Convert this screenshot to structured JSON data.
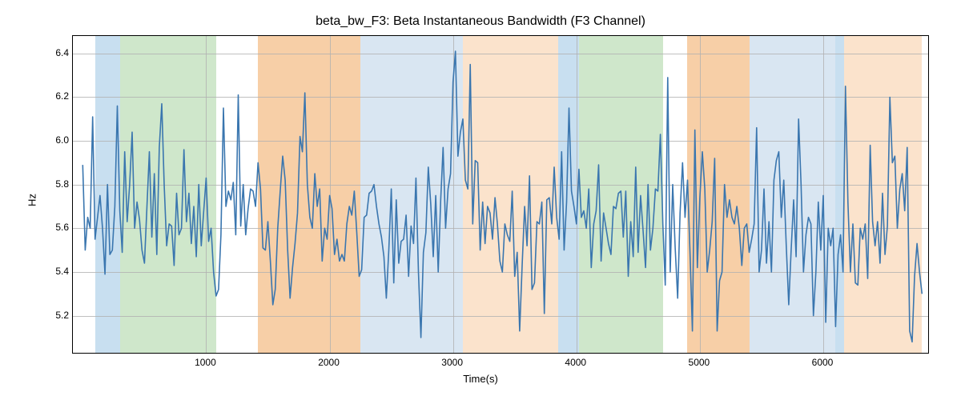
{
  "chart_data": {
    "type": "line",
    "title": "beta_bw_F3: Beta Instantaneous Bandwidth (F3 Channel)",
    "xlabel": "Time(s)",
    "ylabel": "Hz",
    "xlim": [
      -80,
      6850
    ],
    "ylim": [
      5.03,
      6.48
    ],
    "xticks": [
      1000,
      2000,
      3000,
      4000,
      5000,
      6000
    ],
    "yticks": [
      5.2,
      5.4,
      5.6,
      5.8,
      6.0,
      6.2,
      6.4
    ],
    "bands": [
      {
        "start": 100,
        "end": 300,
        "color": "#c8dff0"
      },
      {
        "start": 300,
        "end": 1080,
        "color": "#cfe7cb"
      },
      {
        "start": 1420,
        "end": 2250,
        "color": "#f7cfa7"
      },
      {
        "start": 2250,
        "end": 3080,
        "color": "#d9e6f2"
      },
      {
        "start": 3080,
        "end": 3850,
        "color": "#fbe3cc"
      },
      {
        "start": 3850,
        "end": 4020,
        "color": "#c8dff0"
      },
      {
        "start": 4020,
        "end": 4700,
        "color": "#cfe7cb"
      },
      {
        "start": 4900,
        "end": 5400,
        "color": "#f7cfa7"
      },
      {
        "start": 5400,
        "end": 6100,
        "color": "#d9e6f2"
      },
      {
        "start": 6100,
        "end": 6170,
        "color": "#c8dff0"
      },
      {
        "start": 6170,
        "end": 6800,
        "color": "#fbe3cc"
      }
    ],
    "series": [
      {
        "name": "beta_bw_F3",
        "color": "#3a76af",
        "x": [
          0,
          20,
          40,
          60,
          80,
          100,
          120,
          140,
          160,
          180,
          200,
          220,
          240,
          260,
          280,
          300,
          320,
          340,
          360,
          380,
          400,
          420,
          440,
          460,
          480,
          500,
          520,
          540,
          560,
          580,
          600,
          620,
          640,
          660,
          680,
          700,
          720,
          740,
          760,
          780,
          800,
          820,
          840,
          860,
          880,
          900,
          920,
          940,
          960,
          980,
          1000,
          1020,
          1040,
          1060,
          1080,
          1100,
          1120,
          1140,
          1160,
          1180,
          1200,
          1220,
          1240,
          1260,
          1280,
          1300,
          1320,
          1340,
          1360,
          1380,
          1400,
          1420,
          1440,
          1460,
          1480,
          1500,
          1520,
          1540,
          1560,
          1580,
          1600,
          1620,
          1640,
          1660,
          1680,
          1700,
          1720,
          1740,
          1760,
          1780,
          1800,
          1820,
          1840,
          1860,
          1880,
          1900,
          1920,
          1940,
          1960,
          1980,
          2000,
          2020,
          2040,
          2060,
          2080,
          2100,
          2120,
          2140,
          2160,
          2180,
          2200,
          2220,
          2240,
          2260,
          2280,
          2300,
          2320,
          2340,
          2360,
          2380,
          2400,
          2420,
          2440,
          2460,
          2480,
          2500,
          2520,
          2540,
          2560,
          2580,
          2600,
          2620,
          2640,
          2660,
          2680,
          2700,
          2720,
          2740,
          2760,
          2780,
          2800,
          2820,
          2840,
          2860,
          2880,
          2900,
          2920,
          2940,
          2960,
          2980,
          3000,
          3020,
          3040,
          3060,
          3080,
          3100,
          3120,
          3140,
          3160,
          3180,
          3200,
          3220,
          3240,
          3260,
          3280,
          3300,
          3320,
          3340,
          3360,
          3380,
          3400,
          3420,
          3440,
          3460,
          3480,
          3500,
          3520,
          3540,
          3560,
          3580,
          3600,
          3620,
          3640,
          3660,
          3680,
          3700,
          3720,
          3740,
          3760,
          3780,
          3800,
          3820,
          3840,
          3860,
          3880,
          3900,
          3920,
          3940,
          3960,
          3980,
          4000,
          4020,
          4040,
          4060,
          4080,
          4100,
          4120,
          4140,
          4160,
          4180,
          4200,
          4220,
          4240,
          4260,
          4280,
          4300,
          4320,
          4340,
          4360,
          4380,
          4400,
          4420,
          4440,
          4460,
          4480,
          4500,
          4520,
          4540,
          4560,
          4580,
          4600,
          4620,
          4640,
          4660,
          4680,
          4700,
          4720,
          4740,
          4760,
          4780,
          4800,
          4820,
          4840,
          4860,
          4880,
          4900,
          4920,
          4940,
          4960,
          4980,
          5000,
          5020,
          5040,
          5060,
          5080,
          5100,
          5120,
          5140,
          5160,
          5180,
          5200,
          5220,
          5240,
          5260,
          5280,
          5300,
          5320,
          5340,
          5360,
          5380,
          5400,
          5420,
          5440,
          5460,
          5480,
          5500,
          5520,
          5540,
          5560,
          5580,
          5600,
          5620,
          5640,
          5660,
          5680,
          5700,
          5720,
          5740,
          5760,
          5780,
          5800,
          5820,
          5840,
          5860,
          5880,
          5900,
          5920,
          5940,
          5960,
          5980,
          6000,
          6020,
          6040,
          6060,
          6080,
          6100,
          6120,
          6140,
          6160,
          6180,
          6200,
          6220,
          6240,
          6260,
          6280,
          6300,
          6320,
          6340,
          6360,
          6380,
          6400,
          6420,
          6440,
          6460,
          6480,
          6500,
          6520,
          6540,
          6560,
          6580,
          6600,
          6620,
          6640,
          6660,
          6680,
          6700,
          6720,
          6740,
          6760,
          6780,
          6800
        ],
        "y": [
          5.89,
          5.5,
          5.65,
          5.6,
          6.11,
          5.55,
          5.65,
          5.75,
          5.6,
          5.39,
          5.8,
          5.48,
          5.5,
          5.7,
          6.16,
          5.68,
          5.49,
          5.95,
          5.63,
          5.8,
          6.04,
          5.6,
          5.72,
          5.64,
          5.5,
          5.44,
          5.7,
          5.95,
          5.56,
          5.85,
          5.48,
          5.97,
          6.17,
          5.8,
          5.52,
          5.62,
          5.61,
          5.43,
          5.76,
          5.57,
          5.6,
          5.96,
          5.63,
          5.76,
          5.53,
          5.7,
          5.47,
          5.8,
          5.52,
          5.68,
          5.83,
          5.54,
          5.6,
          5.4,
          5.29,
          5.32,
          5.57,
          6.15,
          5.7,
          5.77,
          5.73,
          5.81,
          5.57,
          6.21,
          5.61,
          5.8,
          5.57,
          5.69,
          5.78,
          5.77,
          5.7,
          5.9,
          5.78,
          5.51,
          5.5,
          5.63,
          5.45,
          5.25,
          5.32,
          5.6,
          5.77,
          5.93,
          5.82,
          5.5,
          5.28,
          5.42,
          5.53,
          5.67,
          6.02,
          5.95,
          6.22,
          5.8,
          5.65,
          5.6,
          5.85,
          5.7,
          5.78,
          5.45,
          5.6,
          5.55,
          5.75,
          5.69,
          5.48,
          5.55,
          5.45,
          5.48,
          5.45,
          5.62,
          5.7,
          5.66,
          5.77,
          5.58,
          5.38,
          5.41,
          5.65,
          5.66,
          5.76,
          5.77,
          5.8,
          5.7,
          5.62,
          5.56,
          5.47,
          5.28,
          5.5,
          5.78,
          5.35,
          5.73,
          5.44,
          5.54,
          5.55,
          5.66,
          5.38,
          5.61,
          5.53,
          5.83,
          5.4,
          5.1,
          5.49,
          5.58,
          5.88,
          5.71,
          5.47,
          5.75,
          5.4,
          5.73,
          5.97,
          5.6,
          5.78,
          5.85,
          6.27,
          6.41,
          5.93,
          6.04,
          6.1,
          5.82,
          5.78,
          6.35,
          5.62,
          5.91,
          5.9,
          5.5,
          5.72,
          5.53,
          5.7,
          5.67,
          5.55,
          5.74,
          5.62,
          5.45,
          5.4,
          5.62,
          5.57,
          5.54,
          5.77,
          5.38,
          5.49,
          5.13,
          5.43,
          5.7,
          5.52,
          5.84,
          5.32,
          5.35,
          5.63,
          5.62,
          5.72,
          5.21,
          5.73,
          5.74,
          5.62,
          5.88,
          5.65,
          5.55,
          5.95,
          5.5,
          5.72,
          6.15,
          5.77,
          5.7,
          5.62,
          5.87,
          5.65,
          5.68,
          5.6,
          5.78,
          5.42,
          5.62,
          5.68,
          5.89,
          5.45,
          5.67,
          5.6,
          5.53,
          5.48,
          5.7,
          5.69,
          5.76,
          5.77,
          5.56,
          5.77,
          5.38,
          5.63,
          5.47,
          5.88,
          5.49,
          5.75,
          5.59,
          5.42,
          5.8,
          5.5,
          5.6,
          5.78,
          5.77,
          6.03,
          5.62,
          5.34,
          6.29,
          5.4,
          5.8,
          5.51,
          5.28,
          5.67,
          5.9,
          5.65,
          5.82,
          5.49,
          5.13,
          6.05,
          5.42,
          5.74,
          5.95,
          5.78,
          5.4,
          5.5,
          5.63,
          5.92,
          5.13,
          5.36,
          5.4,
          5.8,
          5.65,
          5.73,
          5.65,
          5.62,
          5.7,
          5.6,
          5.43,
          5.6,
          5.62,
          5.49,
          5.55,
          5.62,
          6.06,
          5.4,
          5.5,
          5.78,
          5.44,
          5.63,
          5.4,
          5.82,
          5.91,
          5.95,
          5.65,
          5.82,
          5.52,
          5.25,
          5.5,
          5.73,
          5.47,
          6.1,
          5.8,
          5.4,
          5.57,
          5.65,
          5.62,
          5.2,
          5.4,
          5.72,
          5.5,
          5.75,
          5.17,
          5.6,
          5.52,
          5.6,
          5.15,
          5.48,
          5.57,
          5.4,
          6.25,
          5.72,
          5.4,
          5.62,
          5.35,
          5.34,
          5.6,
          5.55,
          5.62,
          5.37,
          5.98,
          5.63,
          5.52,
          5.63,
          5.44,
          5.76,
          5.48,
          5.61,
          6.2,
          5.9,
          5.93,
          5.6,
          5.78,
          5.85,
          5.68,
          5.97,
          5.13,
          5.08,
          5.38,
          5.53,
          5.4,
          5.3
        ]
      }
    ]
  }
}
